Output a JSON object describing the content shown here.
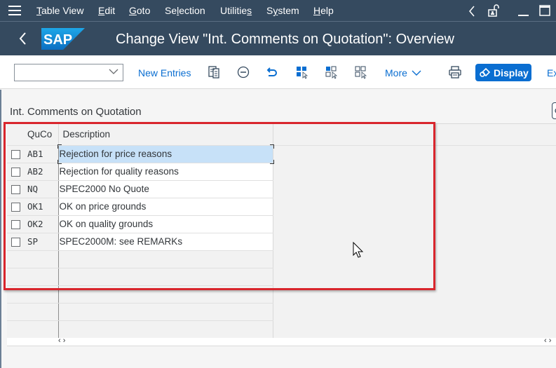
{
  "menubar": {
    "items": [
      {
        "label": "Table View",
        "mnemonic_index": 0
      },
      {
        "label": "Edit",
        "mnemonic_index": 0
      },
      {
        "label": "Goto",
        "mnemonic_index": 0
      },
      {
        "label": "Selection",
        "mnemonic_index": 2
      },
      {
        "label": "Utilities",
        "mnemonic_index": 8
      },
      {
        "label": "System",
        "mnemonic_index": 1
      },
      {
        "label": "Help",
        "mnemonic_index": 0
      }
    ]
  },
  "titlebar": {
    "logo_text": "SAP",
    "title": "Change View \"Int. Comments on Quotation\": Overview"
  },
  "toolbar": {
    "combo_value": "",
    "new_entries_label": "New Entries",
    "more_label": "More",
    "display_label": "Display",
    "exit_label": "Ex"
  },
  "section": {
    "title": "Int. Comments on Quotation"
  },
  "table": {
    "columns": [
      "QuCo",
      "Description"
    ],
    "rows": [
      {
        "code": "AB1",
        "description": "Rejection for price reasons",
        "selected": true
      },
      {
        "code": "AB2",
        "description": "Rejection for quality reasons"
      },
      {
        "code": "NQ",
        "description": "SPEC2000 No Quote"
      },
      {
        "code": "OK1",
        "description": "OK on price grounds"
      },
      {
        "code": "OK2",
        "description": "OK on quality grounds"
      },
      {
        "code": "SP",
        "description": "SPEC2000M: see REMARKs"
      }
    ],
    "empty_rows": 5
  },
  "colors": {
    "shell": "#354a5f",
    "accent": "#0a6ed1",
    "highlight": "#d9262d",
    "selection": "#c7e1f8"
  }
}
